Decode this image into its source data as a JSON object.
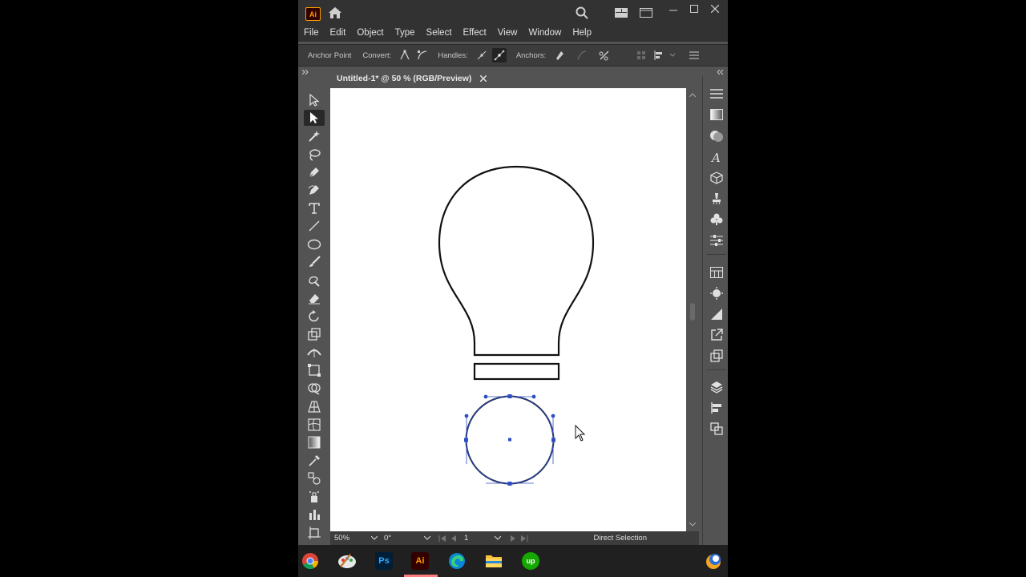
{
  "titlebar": {
    "app_badge": "Ai"
  },
  "menu": [
    "File",
    "Edit",
    "Object",
    "Type",
    "Select",
    "Effect",
    "View",
    "Window",
    "Help"
  ],
  "controlbar": {
    "tool_label": "Anchor Point",
    "convert_label": "Convert:",
    "handles_label": "Handles:",
    "anchors_label": "Anchors:"
  },
  "document": {
    "tab_title": "Untitled-1* @ 50 % (RGB/Preview)"
  },
  "statusbar": {
    "zoom": "50%",
    "rotation": "0°",
    "artboard": "1",
    "current_tool": "Direct Selection"
  },
  "taskbar": {
    "apps": [
      "Chrome",
      "Paint",
      "Ps",
      "Ai",
      "Edge",
      "File Explorer",
      "Upwork"
    ]
  },
  "colors": {
    "accent": "#2c4fc5",
    "ai_brand": "#ff9a00",
    "ps_brand": "#31a8ff",
    "upwork": "#14a800"
  }
}
